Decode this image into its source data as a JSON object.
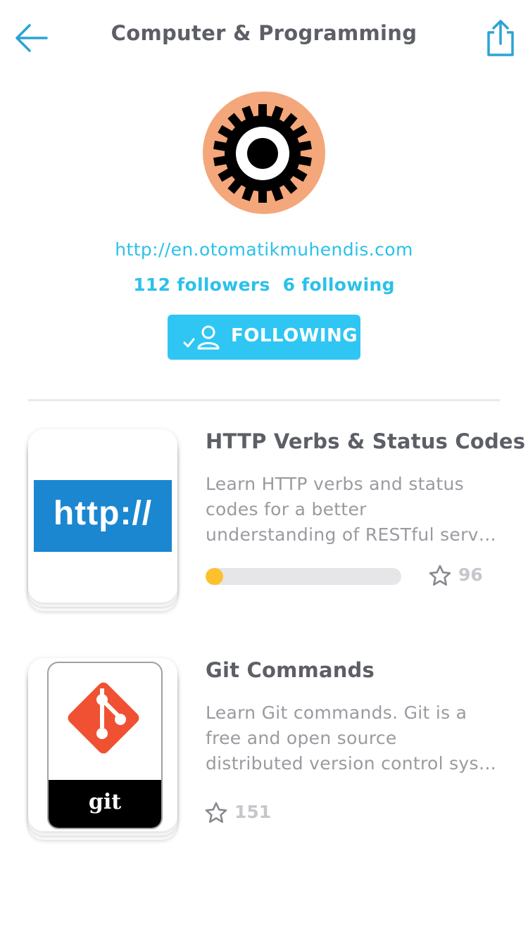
{
  "header": {
    "title": "Computer & Programming"
  },
  "profile": {
    "website": "http://en.otomatikmuhendis.com",
    "followers": "112 followers",
    "following": "6 following",
    "follow_button": "FOLLOWING"
  },
  "courses": [
    {
      "title": "HTTP Verbs & Status Codes",
      "description": [
        "Learn HTTP verbs and status",
        "codes for a better",
        "understanding of RESTful serv…"
      ],
      "cover_text": "http://",
      "progress": 0.09,
      "stars": "96"
    },
    {
      "title": "Git Commands",
      "description": [
        "Learn Git commands. Git is a",
        "free and open source",
        "distributed version control sys…"
      ],
      "cover_text": "git",
      "stars": "151"
    }
  ],
  "colors": {
    "accent": "#2bc1ea",
    "button": "#2fc6f4",
    "avatar_bg": "#f4a77b",
    "progress_fill": "#fdc12e",
    "http_blue": "#1b87d0",
    "git_red": "#f05133"
  },
  "icons": [
    "arrow-left-icon",
    "share-icon",
    "gear-icon",
    "follow-check-user-icon",
    "star-icon",
    "git-logo-icon"
  ]
}
